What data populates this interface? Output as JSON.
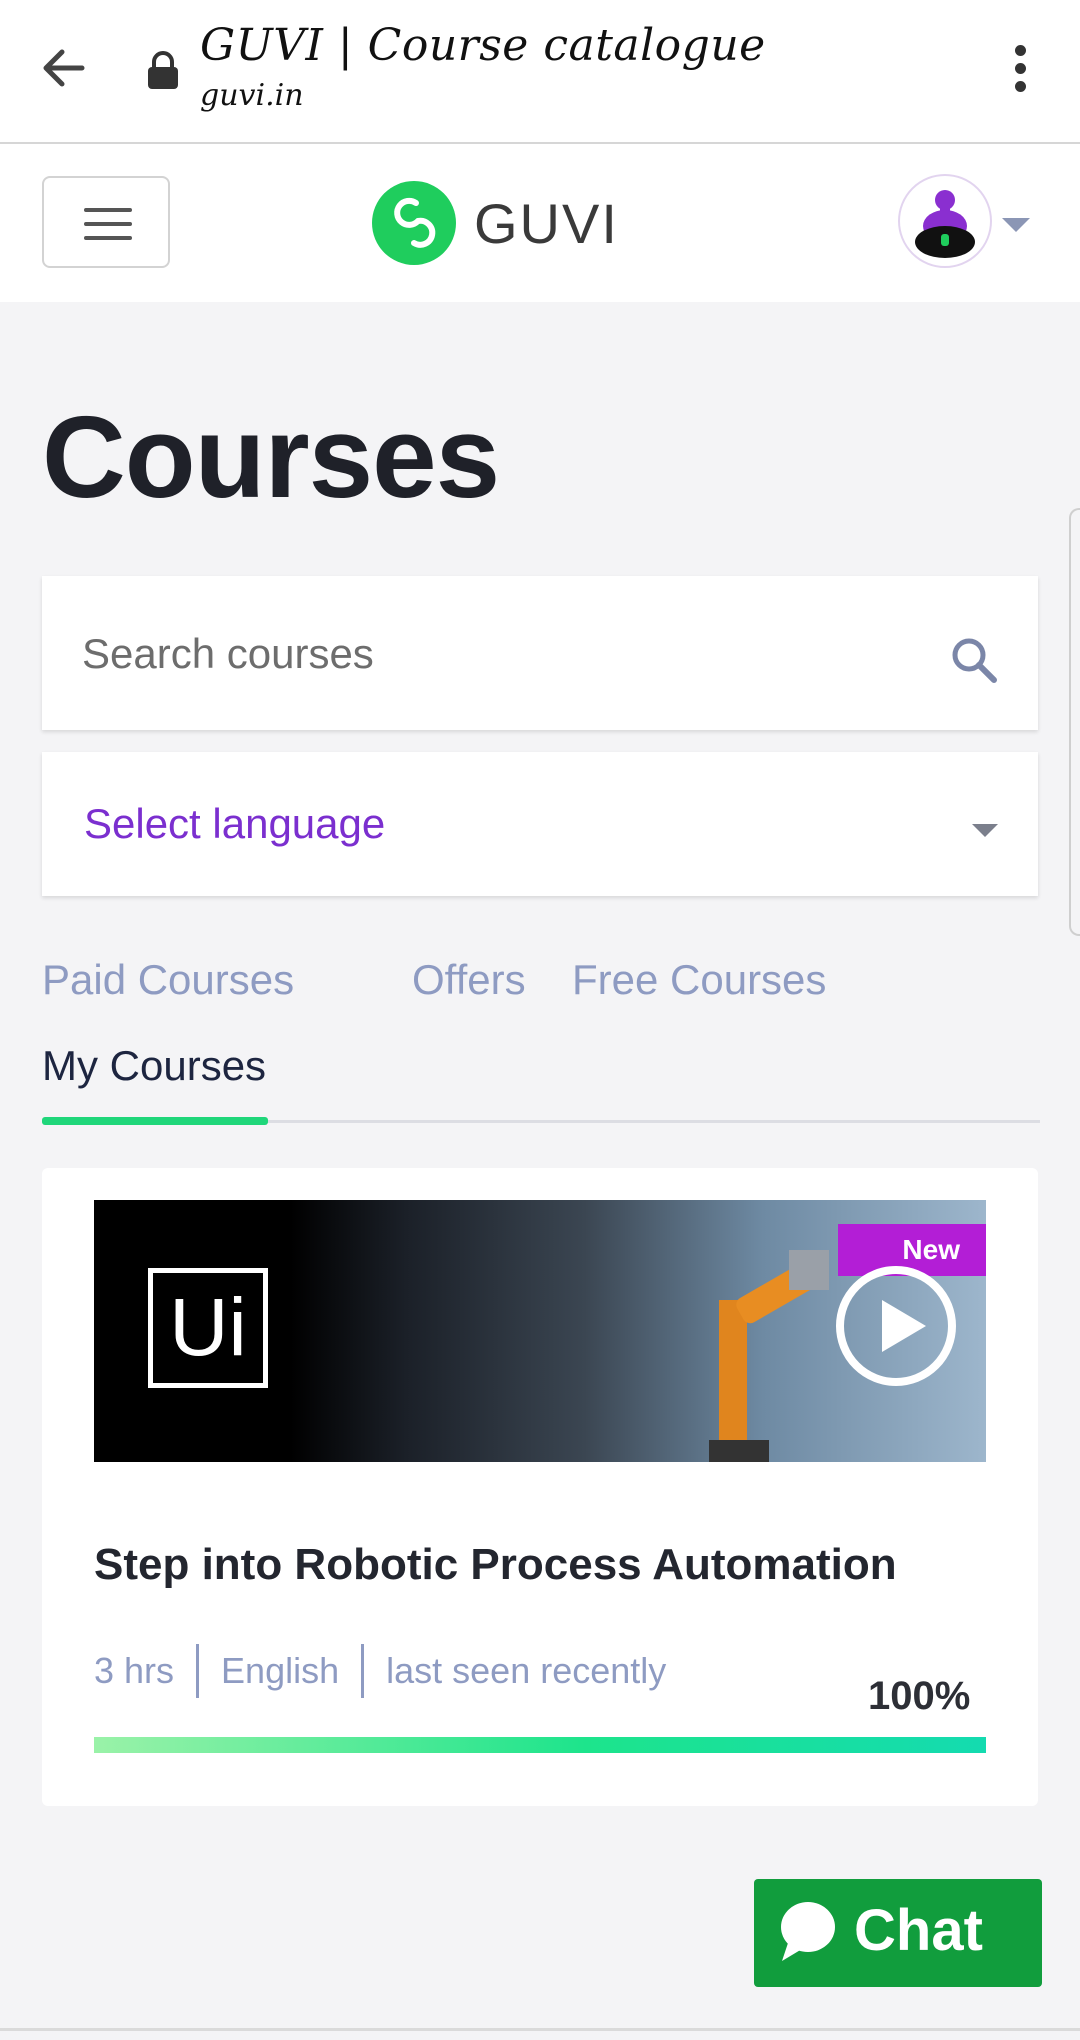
{
  "browser": {
    "title": "GUVI | Course catalogue",
    "url": "guvi.in"
  },
  "header": {
    "brand": "GUVI",
    "brand_color": "#1fcd5d"
  },
  "main": {
    "heading": "Courses",
    "search": {
      "placeholder": "Search courses"
    },
    "language_select": {
      "label": "Select language",
      "color": "#7b2fcf"
    },
    "tabs": [
      {
        "label": "Paid Courses",
        "active": false
      },
      {
        "label": "Offers",
        "active": false
      },
      {
        "label": "Free Courses",
        "active": false
      },
      {
        "label": "My Courses",
        "active": true
      }
    ],
    "courses": [
      {
        "thumbnail_logo": "Ui",
        "badge": "New",
        "title": "Step into Robotic Process Automation",
        "duration": "3 hrs",
        "language": "English",
        "last_seen": "last seen recently",
        "progress_label": "100%",
        "progress": 1.0
      }
    ]
  },
  "chat": {
    "label": "Chat",
    "color": "#119d3d"
  },
  "icons": [
    "arrow-back-icon",
    "lock-icon",
    "more-vert-icon",
    "hamburger-menu-icon",
    "search-icon",
    "chevron-down-icon",
    "play-icon",
    "chat-bubble-icon"
  ]
}
